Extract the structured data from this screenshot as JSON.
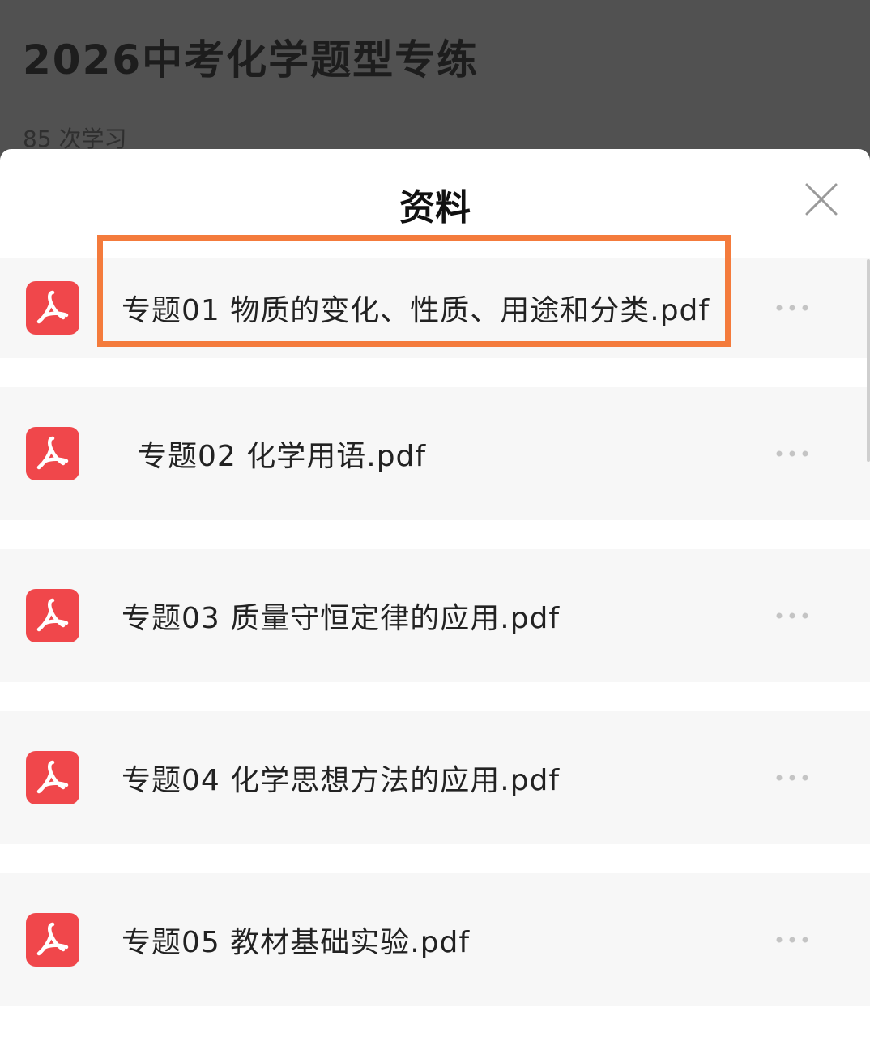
{
  "course": {
    "title": "2026中考化学题型专练",
    "meta": "85 次学习"
  },
  "sheet": {
    "title": "资料"
  },
  "files": [
    {
      "label": "专题01 物质的变化、性质、用途和分类.pdf"
    },
    {
      "label": "专题02 化学用语.pdf"
    },
    {
      "label": "专题03 质量守恒定律的应用.pdf"
    },
    {
      "label": "专题04 化学思想方法的应用.pdf"
    },
    {
      "label": "专题05 教材基础实验.pdf"
    }
  ],
  "colors": {
    "pdf_icon": "#f0474b",
    "highlight": "#f47b3c",
    "backdrop": "#515151"
  },
  "icons": {
    "file": "pdf-icon",
    "more": "more-dots-icon",
    "close": "close-icon"
  }
}
